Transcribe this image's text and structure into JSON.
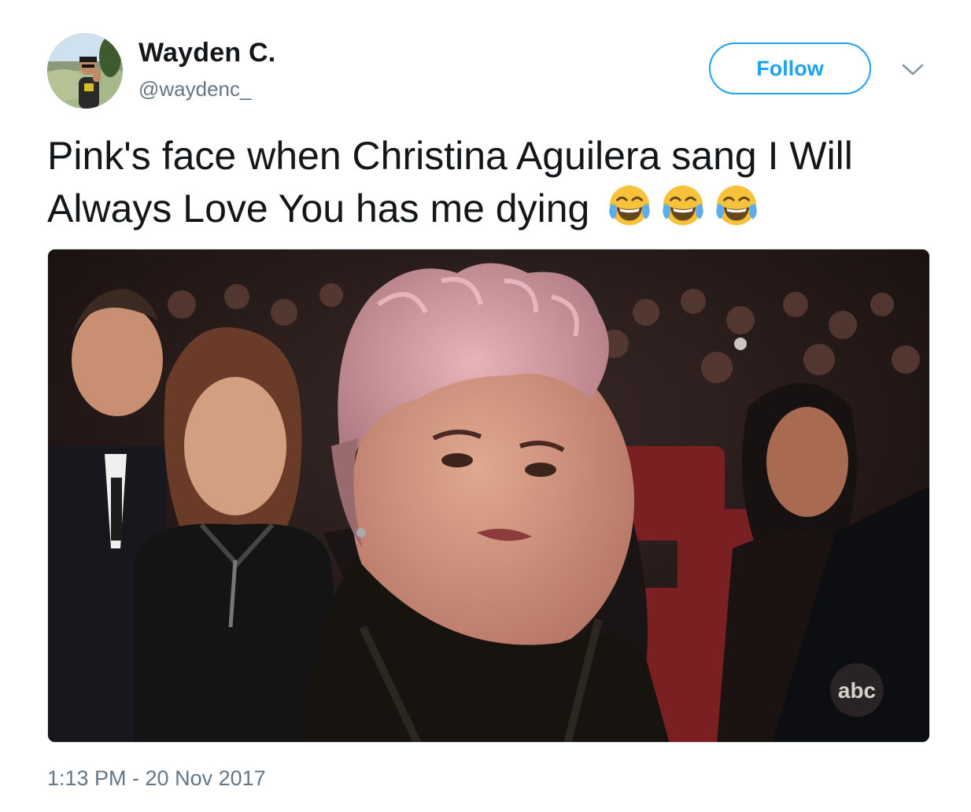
{
  "tweet": {
    "author": {
      "display_name": "Wayden C.",
      "handle": "@waydenc_"
    },
    "follow_label": "Follow",
    "text": "Pink's face when Christina Aguilera sang I Will Always Love You has me dying",
    "emojis": [
      "face-with-tears-of-joy-icon",
      "face-with-tears-of-joy-icon",
      "face-with-tears-of-joy-icon"
    ],
    "timestamp": "1:13 PM - 20 Nov 2017",
    "media": {
      "type": "gif-still",
      "watermark": "abc"
    }
  },
  "colors": {
    "accent": "#1da1f2",
    "text_primary": "#14171a",
    "text_secondary": "#657786",
    "border": "#e1e8ed"
  }
}
